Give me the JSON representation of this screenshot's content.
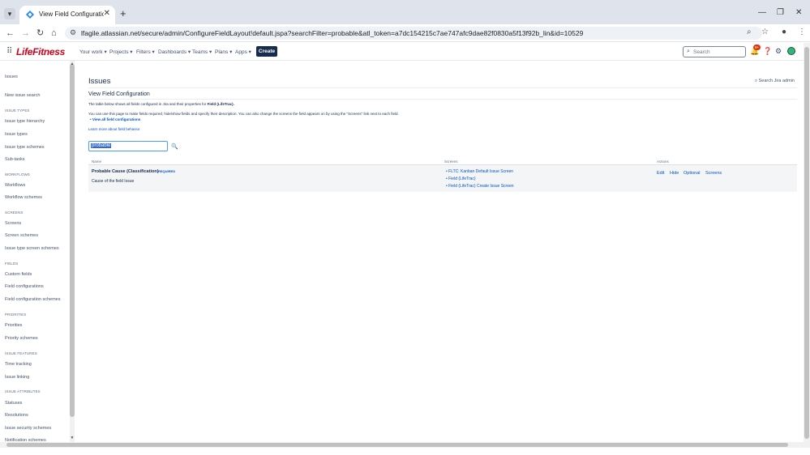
{
  "browser": {
    "tab_title": "View Field Configuration - Life",
    "url": "lfagile.atlassian.net/secure/admin/ConfigureFieldLayout!default.jspa?searchFilter=probable&atl_token=a7dc154215c7ae747afc9dae82f0830a5f13f92b_lin&id=10529"
  },
  "header": {
    "logo": "LifeFitness",
    "nav": [
      "Your work",
      "Projects",
      "Filters",
      "Dashboards",
      "Teams",
      "Plans",
      "Apps"
    ],
    "create_label": "Create",
    "search_placeholder": "Search",
    "notifications_count": "9+"
  },
  "sidebar": {
    "top": "Issues",
    "items": [
      {
        "type": "item",
        "label": "New issue search"
      },
      {
        "type": "heading",
        "label": "ISSUE TYPES"
      },
      {
        "type": "item",
        "label": "Issue type hierarchy"
      },
      {
        "type": "item",
        "label": "Issue types"
      },
      {
        "type": "item",
        "label": "Issue type schemes"
      },
      {
        "type": "item",
        "label": "Sub-tasks"
      },
      {
        "type": "heading",
        "label": "WORKFLOWS"
      },
      {
        "type": "item",
        "label": "Workflows"
      },
      {
        "type": "item",
        "label": "Workflow schemes"
      },
      {
        "type": "heading",
        "label": "SCREENS"
      },
      {
        "type": "item",
        "label": "Screens"
      },
      {
        "type": "item",
        "label": "Screen schemes"
      },
      {
        "type": "item",
        "label": "Issue type screen schemes"
      },
      {
        "type": "heading",
        "label": "FIELDS"
      },
      {
        "type": "item",
        "label": "Custom fields"
      },
      {
        "type": "item",
        "label": "Field configurations"
      },
      {
        "type": "item",
        "label": "Field configuration schemes"
      },
      {
        "type": "heading",
        "label": "PRIORITIES"
      },
      {
        "type": "item",
        "label": "Priorities"
      },
      {
        "type": "item",
        "label": "Priority schemes"
      },
      {
        "type": "heading",
        "label": "ISSUE FEATURES"
      },
      {
        "type": "item",
        "label": "Time tracking"
      },
      {
        "type": "item",
        "label": "Issue linking"
      },
      {
        "type": "heading",
        "label": "ISSUE ATTRIBUTES"
      },
      {
        "type": "item",
        "label": "Statuses"
      },
      {
        "type": "item",
        "label": "Resolutions"
      },
      {
        "type": "item",
        "label": "Issue security schemes"
      },
      {
        "type": "item",
        "label": "Notification schemes"
      }
    ]
  },
  "main": {
    "page_title": "Issues",
    "search_admin": "Search Jira admin",
    "section_title": "View Field Configuration",
    "desc1_prefix": "The table below shows all fields configured in Jira and their properties for ",
    "desc1_bold": "Field (LifeTrac).",
    "desc2": "You can use this page to make fields required, hide/show fields and specify their description. You can also change the screens the field appears on by using the \"Screens\" link next to each field.",
    "view_all_link": "View all field configurations",
    "learn_more": "Learn more about field behavior",
    "filter_value": "probable",
    "table": {
      "columns": [
        "Name",
        "Screens",
        "Actions"
      ],
      "rows": [
        {
          "name": "Probable Cause (Classification)",
          "required": "REQUIRED",
          "description": "Cause of the field Issue",
          "screens": [
            "FLTC: Kanban Default Issue Screen",
            "Field (LifeTrac)",
            "Field (LifeTrac) Create Issue Screen"
          ],
          "actions": [
            "Edit",
            "Hide",
            "Optional",
            "Screens"
          ]
        }
      ]
    }
  }
}
